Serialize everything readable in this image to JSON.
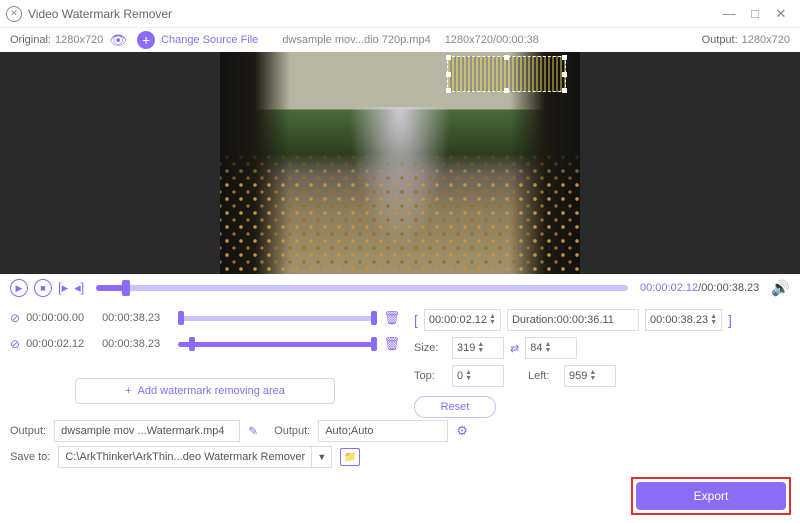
{
  "window": {
    "title": "Video Watermark Remover"
  },
  "info": {
    "original_label": "Original:",
    "original_res": "1280x720",
    "change_source": "Change Source File",
    "filename": "dwsample mov...dio 720p.mp4",
    "fileres_dur": "1280x720/00:00:38",
    "output_label": "Output:",
    "output_res": "1280x720"
  },
  "playback": {
    "current": "00:00:02.12",
    "total": "00:00:38.23",
    "progress_pct": 5.5
  },
  "segments": [
    {
      "start": "00:00:00.00",
      "end": "00:00:38.23",
      "a_pct": 0,
      "b_pct": 100
    },
    {
      "start": "00:00:02.12",
      "end": "00:00:38.23",
      "a_pct": 5.5,
      "b_pct": 100
    }
  ],
  "add_area_label": "Add watermark removing area",
  "range": {
    "start": "00:00:02.12",
    "duration_label": "Duration:00:00:36.11",
    "end": "00:00:38.23"
  },
  "size": {
    "label": "Size:",
    "w": "319",
    "h": "84"
  },
  "pos": {
    "top_label": "Top:",
    "top": "0",
    "left_label": "Left:",
    "left": "959"
  },
  "reset": "Reset",
  "output": {
    "label": "Output:",
    "filename": "dwsample mov ...Watermark.mp4",
    "fmt_label": "Output:",
    "format": "Auto;Auto"
  },
  "save": {
    "label": "Save to:",
    "path": "C:\\ArkThinker\\ArkThin...deo Watermark Remover"
  },
  "export": "Export",
  "selection": {
    "left_pct": 63,
    "top_pct": 2,
    "w_pct": 33,
    "h_pct": 16
  }
}
